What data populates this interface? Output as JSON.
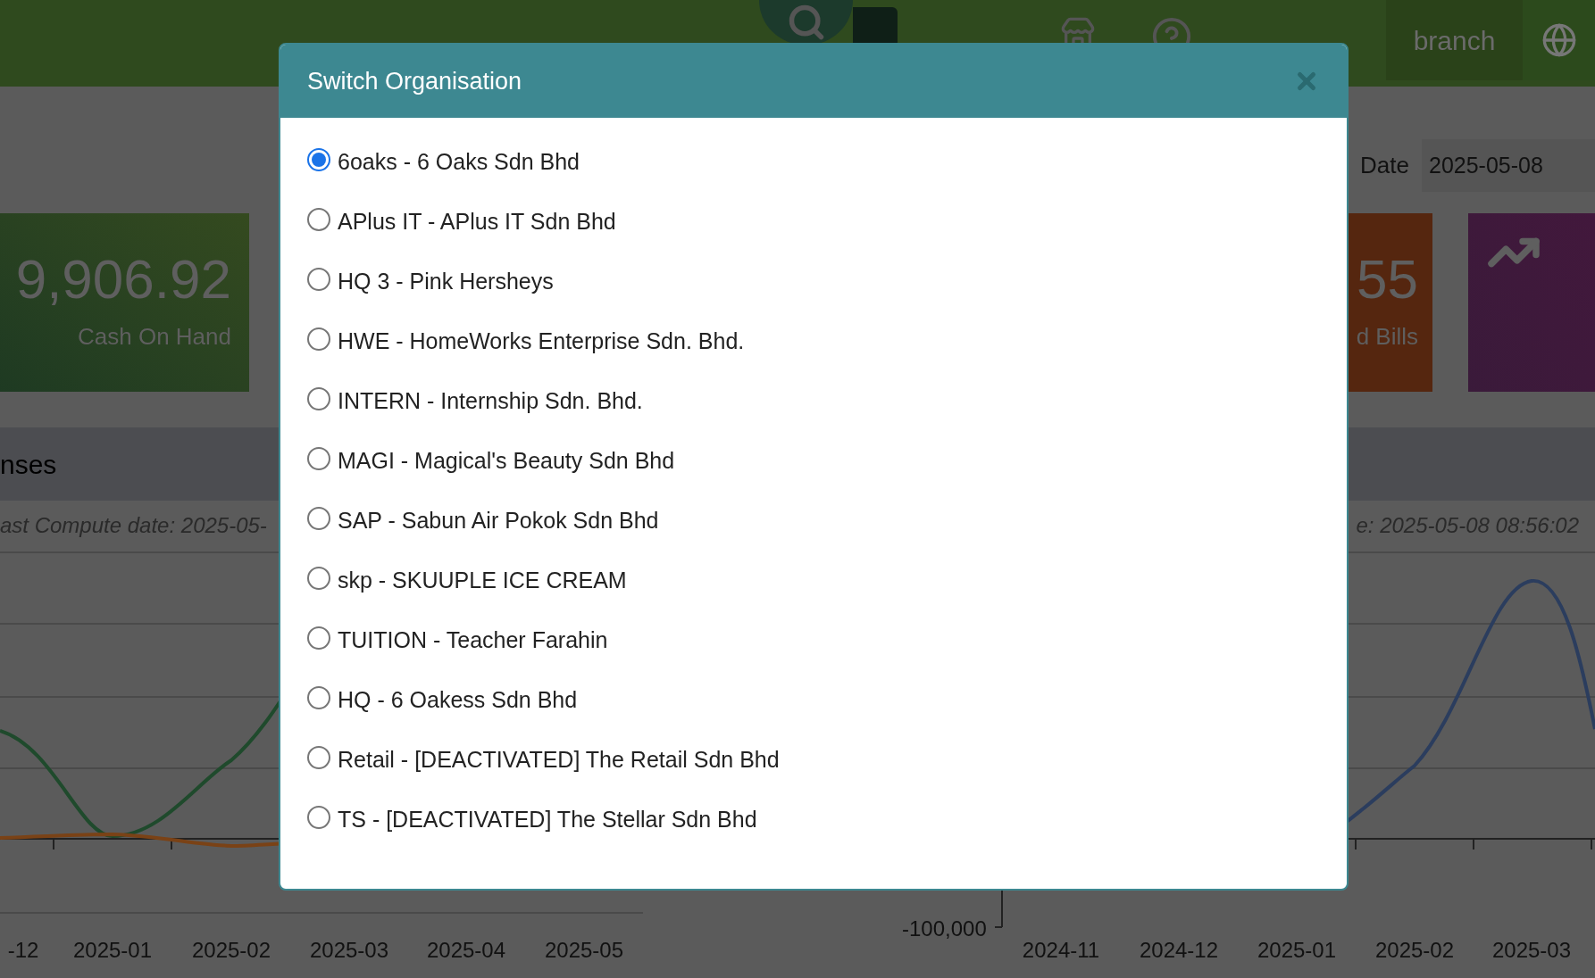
{
  "topbar": {
    "branch": "branch"
  },
  "filter": {
    "label": "Date",
    "value": "2025-05-08"
  },
  "cash_card": {
    "value": "9,906.92",
    "label": "Cash On Hand"
  },
  "bills_card": {
    "value": "55",
    "label": "d Bills"
  },
  "section": {
    "title": "nses"
  },
  "compute_left": "ast Compute date: 2025-05-",
  "compute_right": "e: 2025-05-08 08:56:02",
  "left_chart": {
    "x_labels": [
      "-12",
      "2025-01",
      "2025-02",
      "2025-03",
      "2025-04",
      "2025-05"
    ]
  },
  "right_chart": {
    "y_label": "-100,000",
    "x_labels": [
      "2024-11",
      "2024-12",
      "2025-01",
      "2025-02",
      "2025-03"
    ]
  },
  "modal": {
    "title": "Switch Organisation",
    "options": [
      {
        "label": "6oaks - 6 Oaks Sdn Bhd",
        "selected": true
      },
      {
        "label": "APlus IT - APlus IT Sdn Bhd",
        "selected": false
      },
      {
        "label": "HQ 3 - Pink Hersheys",
        "selected": false
      },
      {
        "label": "HWE - HomeWorks Enterprise Sdn. Bhd.",
        "selected": false
      },
      {
        "label": "INTERN - Internship Sdn. Bhd.",
        "selected": false
      },
      {
        "label": "MAGI - Magical's Beauty Sdn Bhd",
        "selected": false
      },
      {
        "label": "SAP - Sabun Air Pokok Sdn Bhd",
        "selected": false
      },
      {
        "label": "skp - SKUUPLE ICE CREAM",
        "selected": false
      },
      {
        "label": "TUITION - Teacher Farahin",
        "selected": false
      },
      {
        "label": "HQ - 6 Oakess Sdn Bhd",
        "selected": false
      },
      {
        "label": "Retail - [DEACTIVATED] The Retail Sdn Bhd",
        "selected": false
      },
      {
        "label": "TS - [DEACTIVATED] The Stellar Sdn Bhd",
        "selected": false
      }
    ]
  }
}
